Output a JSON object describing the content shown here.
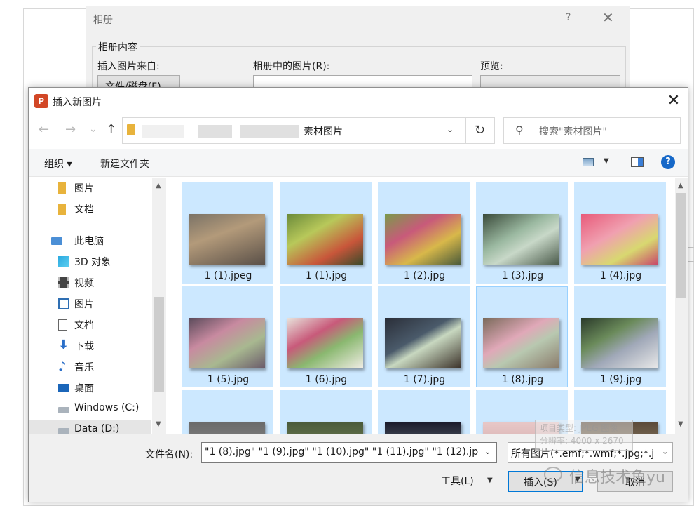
{
  "album": {
    "title": "相册",
    "help": "?",
    "group_label": "相册内容",
    "insert_from_label": "插入图片来自:",
    "pictures_in_album_label": "相册中的图片(R):",
    "preview_label": "预览:",
    "file_button": "文件/磁盘(F)..."
  },
  "dialog": {
    "title": "插入新图片",
    "app_icon_letter": "P",
    "close": "✕"
  },
  "nav": {
    "back": "←",
    "forward": "→",
    "recent": "⌄",
    "up": "↑",
    "address_tail": "素材图片",
    "refresh": "↻",
    "search_placeholder": "搜索\"素材图片\""
  },
  "toolbar": {
    "organize": "组织 ▾",
    "new_folder": "新建文件夹",
    "help": "?"
  },
  "sidebar": {
    "items": [
      {
        "label": "图片",
        "icon": "folder-icon",
        "selected": false
      },
      {
        "label": "文档",
        "icon": "folder-icon",
        "selected": false
      },
      {
        "label": "此电脑",
        "icon": "computer-icon",
        "selected": false
      },
      {
        "label": "3D 对象",
        "icon": "cube-icon",
        "selected": false
      },
      {
        "label": "视频",
        "icon": "film-icon",
        "selected": false
      },
      {
        "label": "图片",
        "icon": "picture-icon",
        "selected": false
      },
      {
        "label": "文档",
        "icon": "document-icon",
        "selected": false
      },
      {
        "label": "下载",
        "icon": "download-arrow-icon",
        "selected": false
      },
      {
        "label": "音乐",
        "icon": "music-note-icon",
        "selected": false
      },
      {
        "label": "桌面",
        "icon": "desktop-icon",
        "selected": false
      },
      {
        "label": "Windows (C:)",
        "icon": "drive-icon",
        "selected": false
      },
      {
        "label": "Data (D:)",
        "icon": "drive-icon",
        "selected": true
      }
    ]
  },
  "files": [
    {
      "name": "1 (1).jpeg",
      "selected": true
    },
    {
      "name": "1 (1).jpg",
      "selected": true
    },
    {
      "name": "1 (2).jpg",
      "selected": true
    },
    {
      "name": "1 (3).jpg",
      "selected": true
    },
    {
      "name": "1 (4).jpg",
      "selected": true
    },
    {
      "name": "1 (5).jpg",
      "selected": true
    },
    {
      "name": "1 (6).jpg",
      "selected": true
    },
    {
      "name": "1 (7).jpg",
      "selected": true
    },
    {
      "name": "1 (8).jpg",
      "selected": true,
      "focused": true
    },
    {
      "name": "1 (9).jpg",
      "selected": true
    },
    {
      "name": "",
      "selected": true
    },
    {
      "name": "",
      "selected": true
    },
    {
      "name": "",
      "selected": true
    },
    {
      "name": "",
      "selected": true
    },
    {
      "name": "",
      "selected": true
    }
  ],
  "bottom": {
    "filename_label": "文件名(N):",
    "filename_value": "\"1 (8).jpg\" \"1 (9).jpg\" \"1 (10).jpg\" \"1 (11).jpg\" \"1 (12).jp",
    "filter_value": "所有图片(*.emf;*.wmf;*.jpg;*.j",
    "tools": "工具(L)",
    "insert": "插入(S)",
    "cancel": "取消"
  },
  "watermark": {
    "card_line1": "项目类型: JPEG 图像",
    "card_line2": "分辨率: 4000 x 2670",
    "text": "信息技术鱼yu"
  },
  "colors": {
    "selection": "#cce8ff",
    "selection_border": "#99d1ff",
    "accent": "#0078d7",
    "powerpoint": "#d24726"
  }
}
